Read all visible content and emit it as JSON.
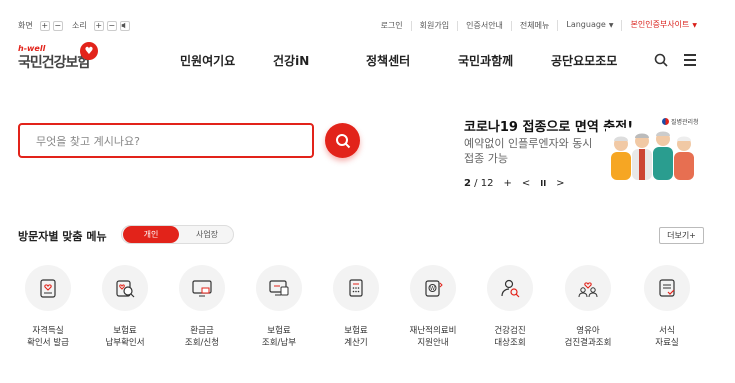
{
  "topbar": {
    "screen_label": "화면",
    "sound_label": "소리",
    "plus": "+",
    "minus": "−",
    "util_items": [
      "로그인",
      "회원가입",
      "인증서안내",
      "전체메뉴",
      "Language"
    ],
    "family_site": "본인인증부사이트"
  },
  "logo": {
    "hwell": "h-well",
    "name": "국민건강보험"
  },
  "gnb": [
    "민원여기요",
    "건강iN",
    "정책센터",
    "국민과함께",
    "공단요모조모"
  ],
  "search": {
    "placeholder": "무엇을 찾고 계시나요?"
  },
  "banner": {
    "title": "코로나19 접종으로 면역 충전!",
    "desc": "예약없이 인플루엔자와 동시접종 가능",
    "org": "질병관리청",
    "page": "2",
    "total": "/ 12",
    "plus": "+",
    "prev": "<",
    "pause": "II",
    "next": ">"
  },
  "visit": {
    "title": "방문자별 맞춤 메뉴",
    "tab_personal": "개인",
    "tab_business": "사업장",
    "more": "더보기+"
  },
  "services": [
    {
      "line1": "자격득실",
      "line2": "확인서 발급",
      "icon": "document-heart-icon"
    },
    {
      "line1": "보험료",
      "line2": "납부확인서",
      "icon": "search-document-icon"
    },
    {
      "line1": "환급금",
      "line2": "조회/신청",
      "icon": "monitor-refund-icon"
    },
    {
      "line1": "보험료",
      "line2": "조회/납부",
      "icon": "monitor-card-icon"
    },
    {
      "line1": "보험료",
      "line2": "계산기",
      "icon": "calculator-icon"
    },
    {
      "line1": "재난적의료비",
      "line2": "지원안내",
      "icon": "medical-support-icon"
    },
    {
      "line1": "건강검진",
      "line2": "대상조회",
      "icon": "person-search-icon"
    },
    {
      "line1": "영유아",
      "line2": "검진결과조회",
      "icon": "family-heart-icon"
    },
    {
      "line1": "서식",
      "line2": "자료실",
      "icon": "form-document-icon"
    }
  ],
  "colors": {
    "brand": "#e2231a",
    "text": "#222222",
    "icon_bg": "#f3f3f3"
  }
}
